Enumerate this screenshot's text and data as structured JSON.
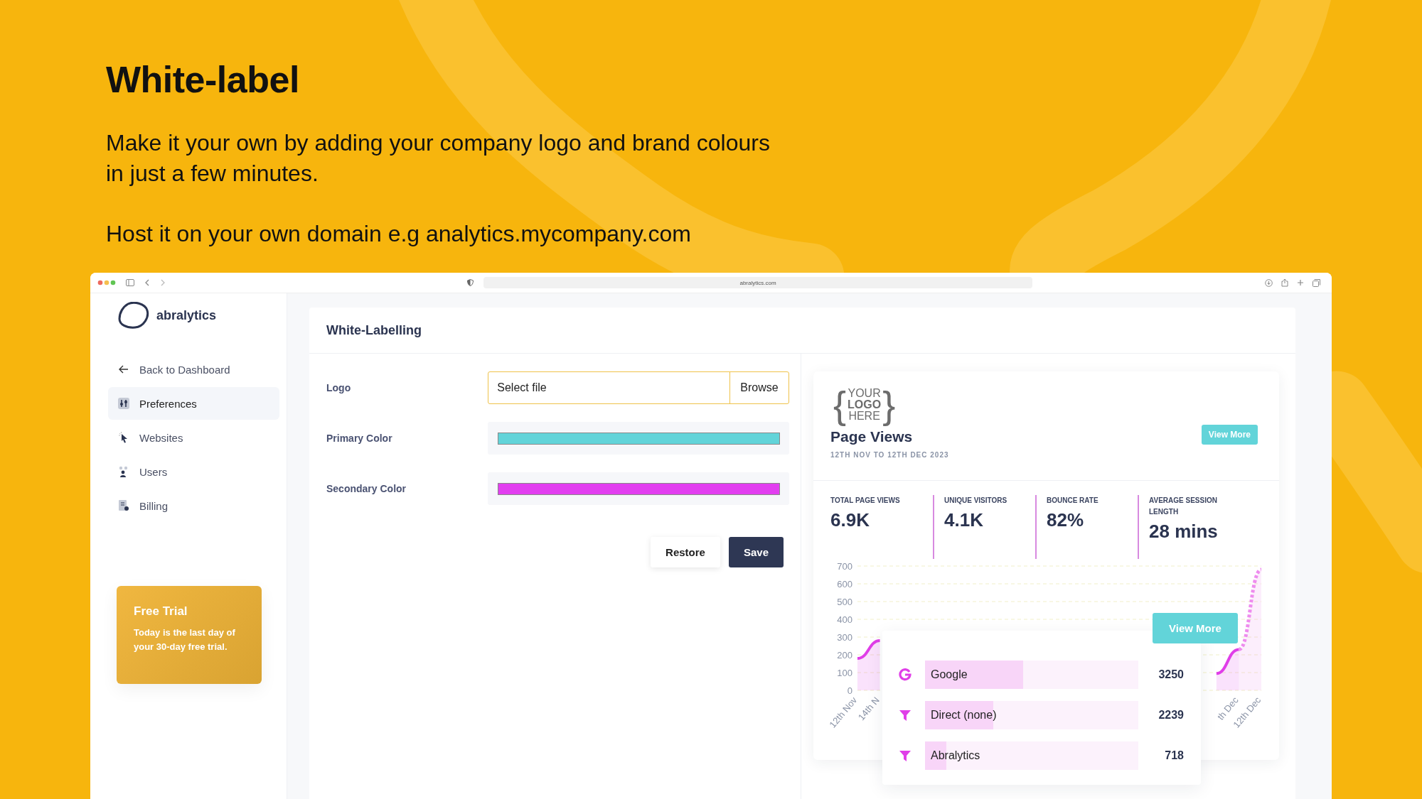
{
  "hero": {
    "title": "White-label",
    "text": "Make it your own by adding your company logo and brand colours in just a few minutes.",
    "host": "Host it on your own domain e.g analytics.mycompany.com"
  },
  "browser": {
    "url": "abralytics.com"
  },
  "sidebar": {
    "brand": "abralytics",
    "items": [
      {
        "label": "Back to Dashboard",
        "kind": "back",
        "selected": false
      },
      {
        "label": "Preferences",
        "kind": "preferences",
        "selected": true
      },
      {
        "label": "Websites",
        "kind": "websites",
        "selected": false
      },
      {
        "label": "Users",
        "kind": "users",
        "selected": false
      },
      {
        "label": "Billing",
        "kind": "billing",
        "selected": false
      }
    ],
    "trial": {
      "title": "Free Trial",
      "text": "Today is the last day of your 30-day free trial."
    }
  },
  "settings": {
    "title": "White-Labelling",
    "logo": {
      "label": "Logo",
      "placeholder": "Select file",
      "button": "Browse"
    },
    "colors": [
      {
        "label": "Primary Color",
        "color": "#62d4d9"
      },
      {
        "label": "Secondary Color",
        "color": "#e23ef0"
      }
    ],
    "buttons": [
      {
        "label": "Restore",
        "kind": "secondary"
      },
      {
        "label": "Save",
        "kind": "primary"
      }
    ]
  },
  "preview": {
    "logo": {
      "open": "{",
      "lines": [
        "YOUR",
        "LOGO",
        "HERE"
      ],
      "close": "}"
    },
    "title": "Page Views",
    "range": "12TH NOV TO 12TH DEC 2023",
    "button": "View More",
    "stats": [
      {
        "label": "TOTAL PAGE VIEWS",
        "value": "6.9K"
      },
      {
        "label": "UNIQUE VISITORS",
        "value": "4.1K"
      },
      {
        "label": "BOUNCE RATE",
        "value": "82%"
      },
      {
        "label": "AVERAGE SESSION LENGTH",
        "value": "28 mins"
      }
    ],
    "chart_data": {
      "type": "area",
      "grid": true,
      "categories": [
        "12th Nov",
        "14th N",
        null,
        null,
        null,
        null,
        null,
        null,
        null,
        null,
        null,
        null,
        null,
        null,
        null,
        null,
        null,
        "th Dec",
        "12th Dec"
      ],
      "series": [
        {
          "color": "#e03ee8",
          "line_style": "solid",
          "values": [
            180,
            280,
            null,
            null,
            null,
            null,
            null,
            null,
            null,
            null,
            null,
            null,
            null,
            null,
            null,
            null,
            95,
            230,
            null
          ]
        },
        {
          "color": "#ee8cee",
          "line_style": "dotted",
          "values": [
            null,
            null,
            null,
            null,
            null,
            null,
            null,
            null,
            null,
            null,
            null,
            null,
            null,
            null,
            null,
            null,
            null,
            230,
            680
          ]
        }
      ],
      "ylim": [
        0,
        700
      ],
      "yticks": [
        0,
        100,
        200,
        300,
        400,
        500,
        600,
        700
      ]
    },
    "sources": {
      "button": "View More",
      "rows": [
        {
          "kind": "google",
          "label": "Google",
          "value": "3250",
          "level": 0.46
        },
        {
          "kind": "funnel",
          "label": "Direct (none)",
          "value": "2239",
          "level": 0.32
        },
        {
          "kind": "funnel",
          "label": "Abralytics",
          "value": "718",
          "level": 0.1
        }
      ]
    }
  }
}
